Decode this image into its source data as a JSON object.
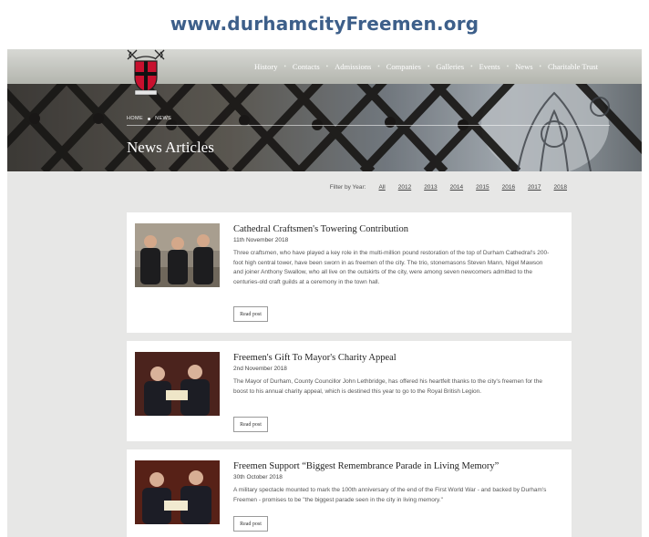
{
  "header": {
    "url_title": "www.durhamcityFreemen.org"
  },
  "nav": {
    "items": [
      "History",
      "Contacts",
      "Admissions",
      "Companies",
      "Galleries",
      "Events",
      "News",
      "Charitable Trust"
    ],
    "separator": "•"
  },
  "hero": {
    "breadcrumb": [
      "HOME",
      "NEWS"
    ],
    "title": "News Articles"
  },
  "filter": {
    "label": "Filter by Year:",
    "years": [
      "All",
      "2012",
      "2013",
      "2014",
      "2015",
      "2016",
      "2017",
      "2018"
    ]
  },
  "articles": [
    {
      "title": "Cathedral Craftsmen's Towering Contribution",
      "date": "11th November 2018",
      "summary": "Three craftsmen, who have played a key role in the multi-million pound restoration of the top of Durham Cathedral's 200-foot high central tower, have been sworn in as freemen of the city. The trio, stonemasons Steven Mann, Nigel Mawson and joiner Anthony Swallow, who all live on the outskirts of the city, were among seven newcomers admitted to the centuries-old craft guilds at a ceremony in the town hall.",
      "button": "Read post"
    },
    {
      "title": "Freemen's Gift To Mayor's Charity Appeal",
      "date": "2nd November 2018",
      "summary": "The Mayor of Durham, County Councillor John Lethbridge, has offered his heartfelt thanks to the city's freemen for the boost to his annual charity appeal, which is destined this year to go to the Royal British Legion.",
      "button": "Read post"
    },
    {
      "title": "Freemen Support “Biggest Remembrance Parade in Living Memory”",
      "date": "30th October 2018",
      "summary": "A military spectacle mounted to mark the 100th anniversary of the end of the First World War - and backed by Durham's Freemen - promises to be \"the biggest parade seen in the city in living memory.\"",
      "button": "Read post"
    }
  ],
  "colors": {
    "url_title": "#3d5f8a",
    "page_bg": "#e7e7e6",
    "crest_red": "#c8102e"
  }
}
